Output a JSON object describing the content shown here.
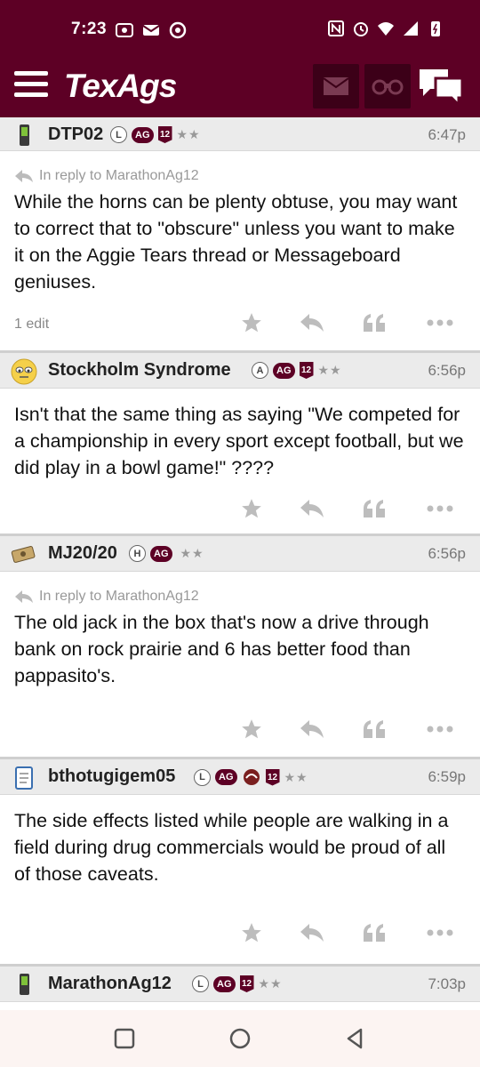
{
  "status_bar": {
    "time": "7:23",
    "left_icons": [
      "radio-icon",
      "mail-icon",
      "chrome-icon"
    ],
    "right_icons": [
      "nfc-icon",
      "alarm-icon",
      "wifi-icon",
      "signal-icon",
      "battery-icon"
    ]
  },
  "header": {
    "logo": "TexAgs",
    "buttons": [
      "menu-icon",
      "mail-icon",
      "binoculars-icon",
      "chat-icon"
    ],
    "colors": {
      "maroon": "#5d0025",
      "dark_button": "#3c0018"
    }
  },
  "posts": [
    {
      "user": "DTP02",
      "avatar": "phone-icon",
      "badges": [
        "L",
        "AG",
        "12",
        "★★"
      ],
      "time": "6:47p",
      "reply_to": "In reply to MarathonAg12",
      "text": "While the horns can be plenty obtuse, you may want to correct that to \"obscure\" unless you want to make it on the Aggie Tears thread or Messageboard geniuses.",
      "edit": "1 edit"
    },
    {
      "user": "Stockholm Syndrome",
      "avatar": "emoji-face-icon",
      "badges": [
        "A",
        "AG",
        "12",
        "★★"
      ],
      "time": "6:56p",
      "reply_to": "",
      "text": "Isn't that the same thing as saying \"We competed for a championship in every sport except football, but we did play in a bowl game!\" ????",
      "edit": ""
    },
    {
      "user": "MJ20/20",
      "avatar": "money-icon",
      "badges": [
        "H",
        "AG",
        "★★"
      ],
      "time": "6:56p",
      "reply_to": "In reply to MarathonAg12",
      "text": "The old jack in the box that's now a drive through bank on rock prairie and 6 has better food than pappasito's.",
      "edit": ""
    },
    {
      "user": "bthotugigem05",
      "avatar": "notepad-icon",
      "badges": [
        "L",
        "AG",
        "logo",
        "12",
        "★★"
      ],
      "time": "6:59p",
      "reply_to": "",
      "text": "The side effects listed while people are walking in a field during drug commercials would be proud of all of those caveats.",
      "edit": ""
    },
    {
      "user": "MarathonAg12",
      "avatar": "phone-icon",
      "badges": [
        "L",
        "AG",
        "12",
        "★★"
      ],
      "time": "7:03p",
      "reply_to": "",
      "text": "",
      "edit": ""
    }
  ],
  "nav": [
    "recents-icon",
    "home-icon",
    "back-icon"
  ]
}
